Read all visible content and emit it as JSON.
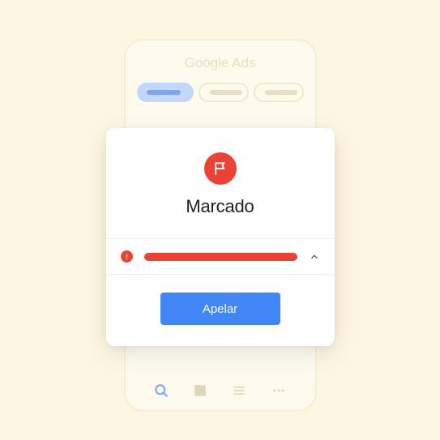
{
  "phone": {
    "title": "Google Ads"
  },
  "card": {
    "title": "Marcado",
    "appeal_label": "Apelar"
  }
}
